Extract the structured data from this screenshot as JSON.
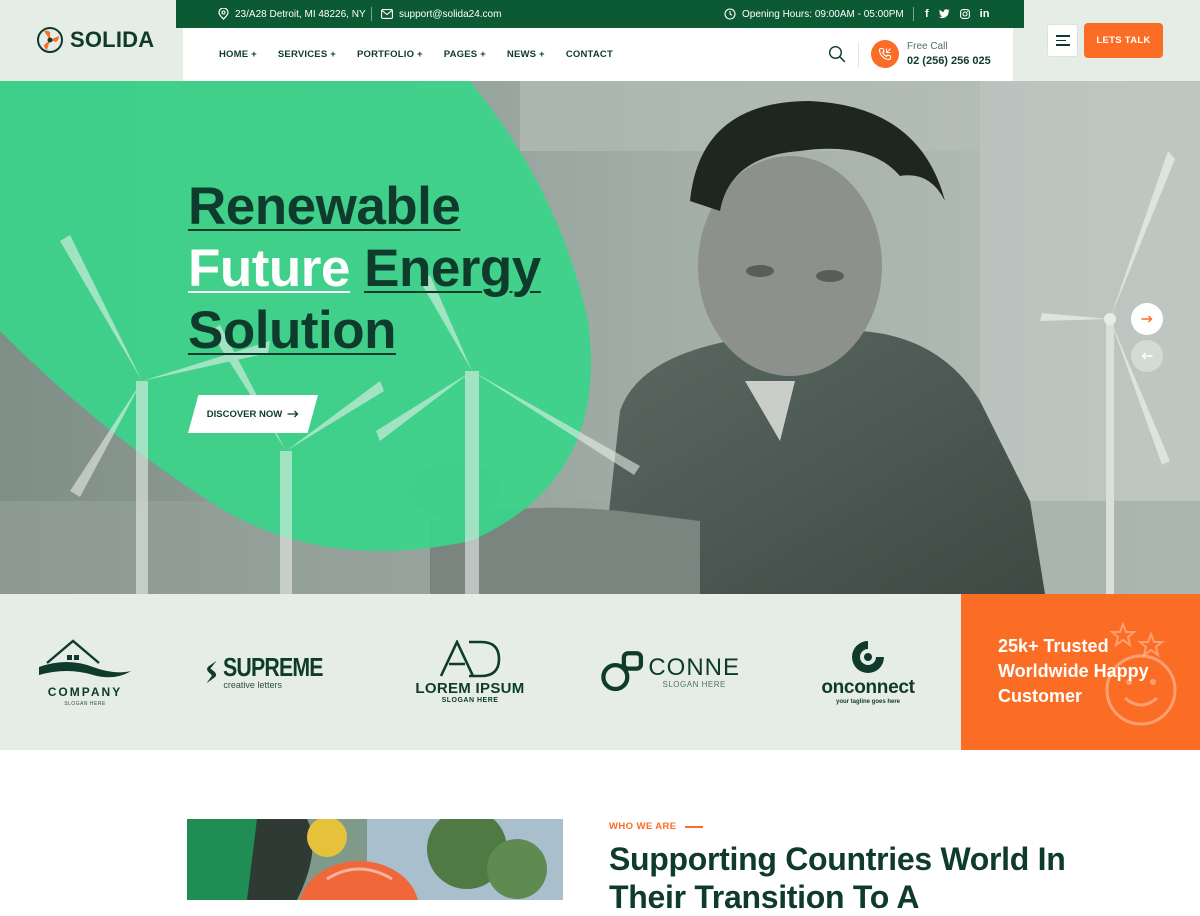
{
  "brand": {
    "name": "SOLIDA"
  },
  "topbar": {
    "address": "23/A28 Detroit, MI 48226, NY",
    "email": "support@solida24.com",
    "hours": "Opening Hours: 09:00AM - 05:00PM",
    "social": [
      "facebook-icon",
      "twitter-icon",
      "instagram-icon",
      "linkedin-icon"
    ]
  },
  "nav": {
    "items": [
      "HOME +",
      "SERVICES +",
      "PORTFOLIO +",
      "PAGES +",
      "NEWS +",
      "CONTACT"
    ],
    "call_label": "Free Call",
    "call_number": "02 (256) 256 025",
    "cta": "LETS TALK"
  },
  "hero": {
    "line1": "Renewable",
    "line2_highlight": "Future",
    "line2_rest": "Energy",
    "line3": "Solution",
    "button": "DISCOVER NOW"
  },
  "brands": {
    "company": {
      "name": "COMPANY",
      "slogan": "SLOGAN HERE"
    },
    "supreme": {
      "name": "SUPREME",
      "tagline": "creative letters"
    },
    "lorem": {
      "mark": "AD",
      "name": "LOREM IPSUM",
      "slogan": "SLOGAN HERE"
    },
    "conne": {
      "name": "CONNE",
      "slogan": "SLOGAN HERE"
    },
    "onconnect": {
      "name": "onconnect",
      "tagline": "your tagline goes here"
    }
  },
  "trust": {
    "text": "25k+ Trusted Worldwide Happy Customer"
  },
  "about": {
    "eyebrow": "WHO WE ARE",
    "title": "Supporting Countries World In Their Transition To A"
  },
  "colors": {
    "dark_green": "#0c5a34",
    "ink": "#0e3b2b",
    "accent_orange": "#fb6d25",
    "mint": "#3ad48a",
    "pale_green": "#e5ede6"
  }
}
